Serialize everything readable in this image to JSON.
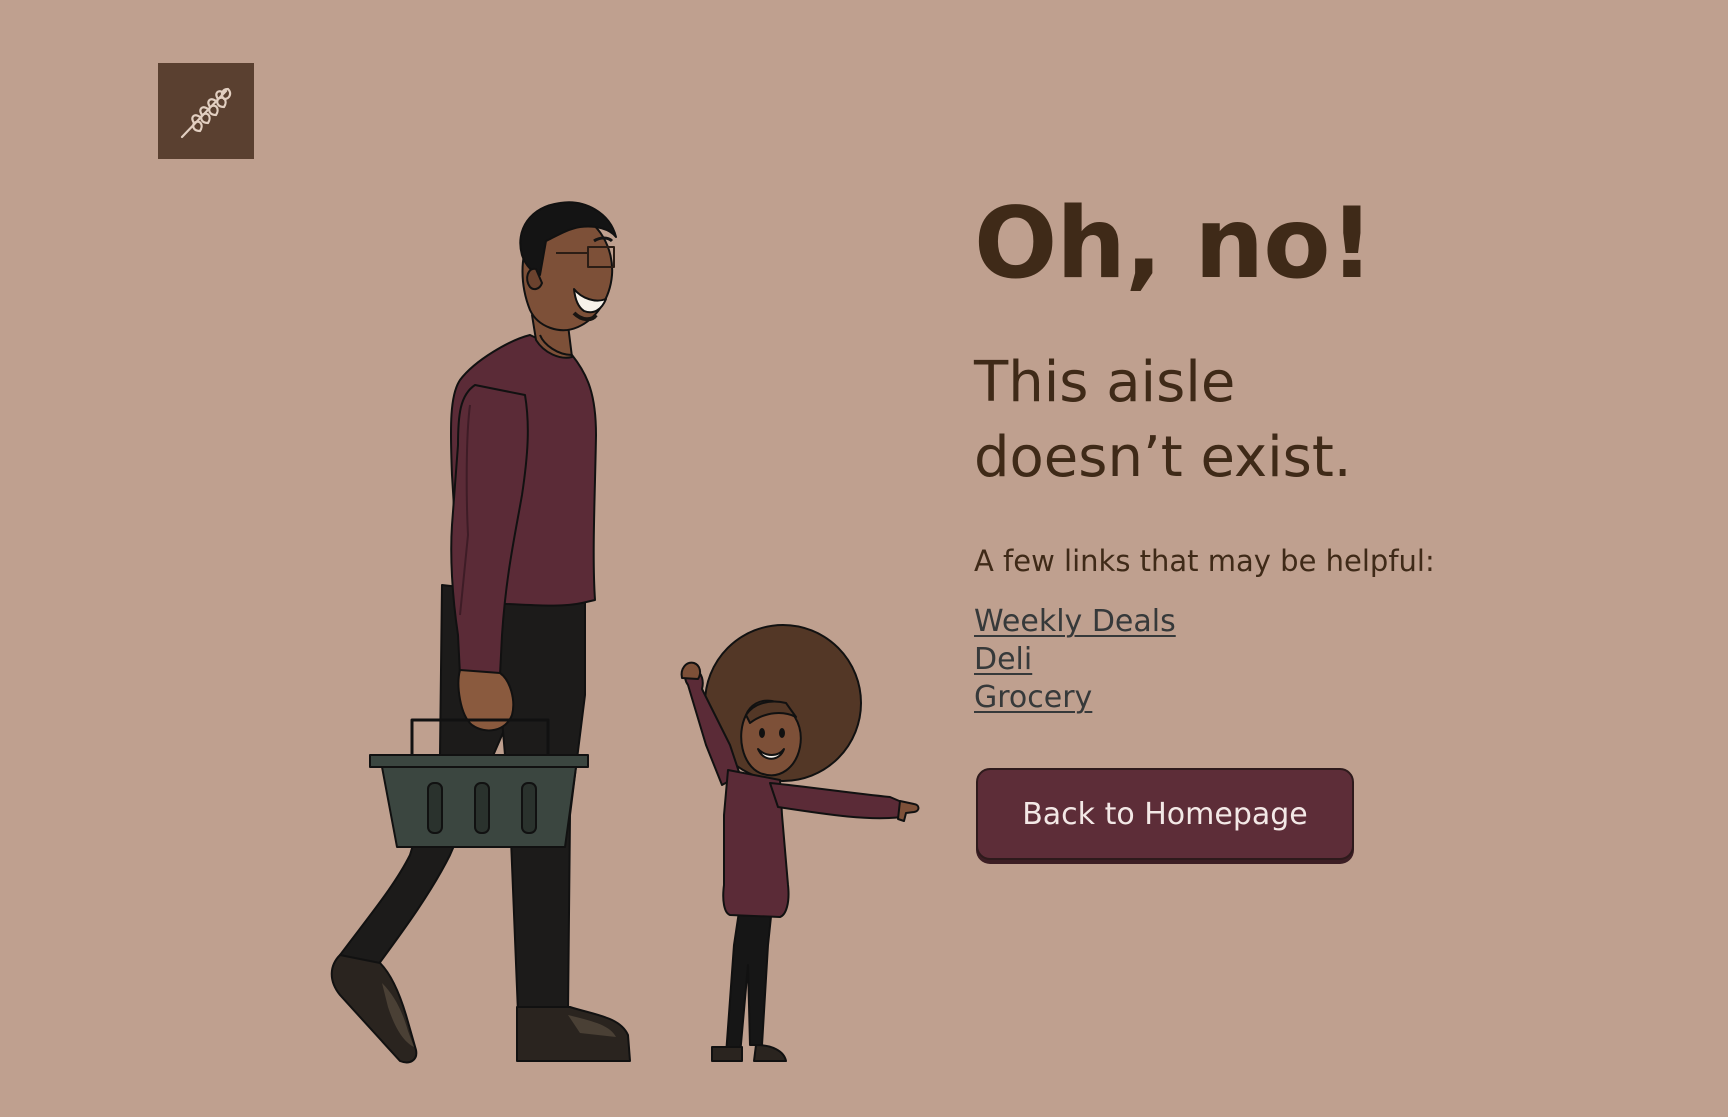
{
  "logo": {
    "icon": "wheat-icon",
    "bg_color": "#5a4030"
  },
  "headline": "Oh, no!",
  "subhead_lines": [
    "This aisle",
    "doesn’t exist."
  ],
  "helper_text": "A few links that may be helpful:",
  "links": [
    {
      "label": "Weekly Deals"
    },
    {
      "label": "Deli"
    },
    {
      "label": "Grocery"
    }
  ],
  "home_button": {
    "label": "Back to Homepage",
    "color": "#5d2d38"
  },
  "colors": {
    "background": "#bfa08f",
    "text": "#3f2a18",
    "link": "#36393a"
  }
}
